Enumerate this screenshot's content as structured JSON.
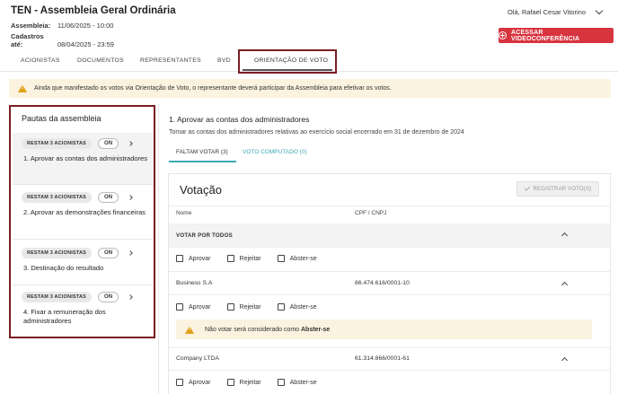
{
  "header": {
    "title": "TEN - Assembleia Geral Ordinária",
    "assembly_label": "Assembleia:",
    "assembly_value": "11/06/2025 - 10:00",
    "registration_label": "Cadastros até:",
    "registration_value": "08/04/2025 - 23:59",
    "user_greeting": "Olá, Rafael Cesar Vitorino",
    "video_button": "ACESSAR VIDEOCONFERÊNCIA"
  },
  "tabs": [
    "ACIONISTAS",
    "DOCUMENTOS",
    "REPRESENTANTES",
    "BVD",
    "ORIENTAÇÃO DE VOTO"
  ],
  "active_tab": "ORIENTAÇÃO DE VOTO",
  "warning": "Ainda que manifestado os votos via Orientação de Voto, o representante deverá participar da Assembleia para efetivar os votos.",
  "sidebar": {
    "title": "Pautas da assembleia",
    "items": [
      {
        "badge": "RESTAM 3 ACIONISTAS",
        "toggle": "ON",
        "label": "1. Aprovar as contas dos administradores"
      },
      {
        "badge": "RESTAM 3 ACIONISTAS",
        "toggle": "ON",
        "label": "2. Aprovar as demonstrações financeiras"
      },
      {
        "badge": "RESTAM 3 ACIONISTAS",
        "toggle": "ON",
        "label": "3. Destinação do resultado"
      },
      {
        "badge": "RESTAM 3 ACIONISTAS",
        "toggle": "ON",
        "label": "4. Fixar a remuneração dos administradores"
      }
    ]
  },
  "main": {
    "title": "1. Aprovar as contas dos administradores",
    "description": "Tomar as contas dos administradores relativas ao exercício social encerrado em 31 de dezembro de 2024",
    "sub_tabs": [
      "FALTAM VOTAR (3)",
      "VOTO COMPUTADO (0)"
    ],
    "card_title": "Votação",
    "register_button": "REGISTRAR VOTO(S)",
    "col_name": "Nome",
    "col_doc": "CPF / CNPJ",
    "vote_all": "VOTAR POR TODOS",
    "options": [
      "Aprovar",
      "Rejeitar",
      "Abster-se"
    ],
    "shareholders": [
      {
        "name": "Business S.A",
        "doc": "86.474.616/0001-10"
      },
      {
        "name": "Company LTDA",
        "doc": "61.314.866/0001-61"
      }
    ],
    "note_text": "Não votar será considerado como ",
    "note_bold": "Abster-se"
  },
  "colors": {
    "accent": "#d8343f",
    "teal": "#3aa8b3",
    "highlight_box": "#7a1f24",
    "warning_bg": "#fbf3df"
  }
}
